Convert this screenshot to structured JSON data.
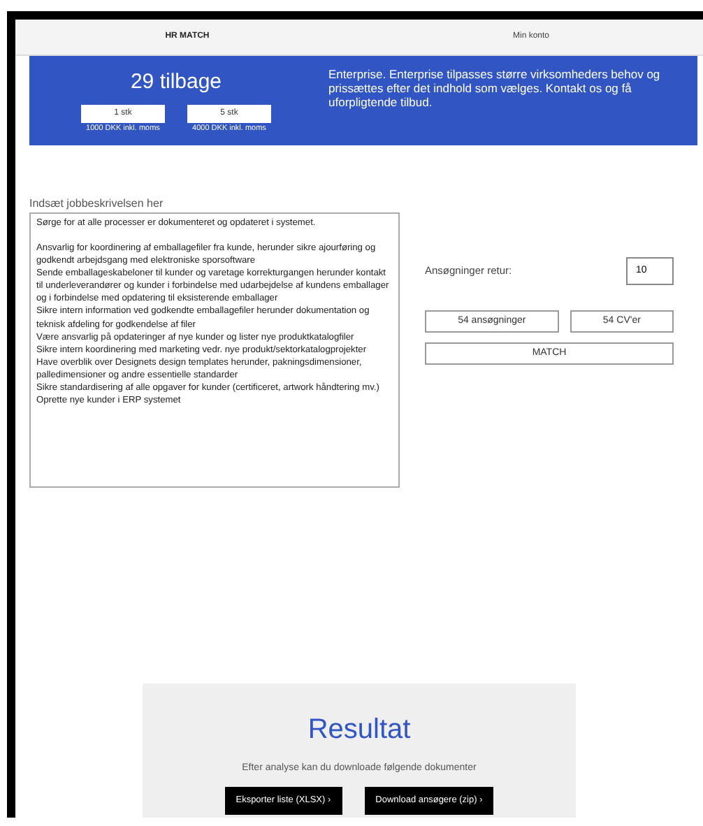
{
  "nav": {
    "tabs": [
      {
        "label": "HR MATCH",
        "selected": true
      },
      {
        "label": "Min konto",
        "selected": false
      }
    ]
  },
  "banner": {
    "credits": "29 tilbage",
    "packages": [
      {
        "button": "1 stk",
        "price": "1000 DKK inkl. moms"
      },
      {
        "button": "5 stk",
        "price": "4000 DKK inkl. moms"
      }
    ],
    "description": "Enterprise. Enterprise tilpasses større virksomheders behov og prissættes efter det indhold som vælges. Kontakt os og få uforpligtende tilbud."
  },
  "job": {
    "label": "Indsæt jobbeskrivelsen her",
    "value": "Sørge for at alle processer er dokumenteret og opdateret i systemet.\n\nAnsvarlig for koordinering af emballagefiler fra kunde, herunder sikre ajourføring og godkendt arbejdsgang med elektroniske sporsoftware\nSende emballageskabeloner til kunder og varetage korrekturgangen herunder kontakt til underleverandører og kunder i forbindelse med udarbejdelse af kundens emballager og i forbindelse med opdatering til eksisterende emballager\nSikre intern information ved godkendte emballagefiler herunder dokumentation og teknisk afdeling for godkendelse af filer\nVære ansvarlig på opdateringer af nye kunder og lister nye produktkatalogfiler\nSikre intern koordinering med marketing vedr. nye produkt/sektorkatalogprojekter\nHave overblik over Designets design templates herunder, pakningsdimensioner, palledimensioner og andre essentielle standarder\nSikre standardisering af alle opgaver for kunder (certificeret, artwork håndtering mv.)\nOprette nye kunder i ERP systemet"
  },
  "match": {
    "returns_label": "Ansøgninger retur:",
    "returns_value": "10",
    "applications_button": "54 ansøgninger",
    "cv_button": "54 CV'er",
    "match_button": "MATCH"
  },
  "result": {
    "title": "Resultat",
    "text": "Efter analyse kan du downloade følgende dokumenter",
    "buttons": [
      {
        "label": "Eksporter liste (XLSX)",
        "arrow": "›"
      },
      {
        "label": "Download ansøgere (zip)",
        "arrow": "›"
      }
    ]
  }
}
